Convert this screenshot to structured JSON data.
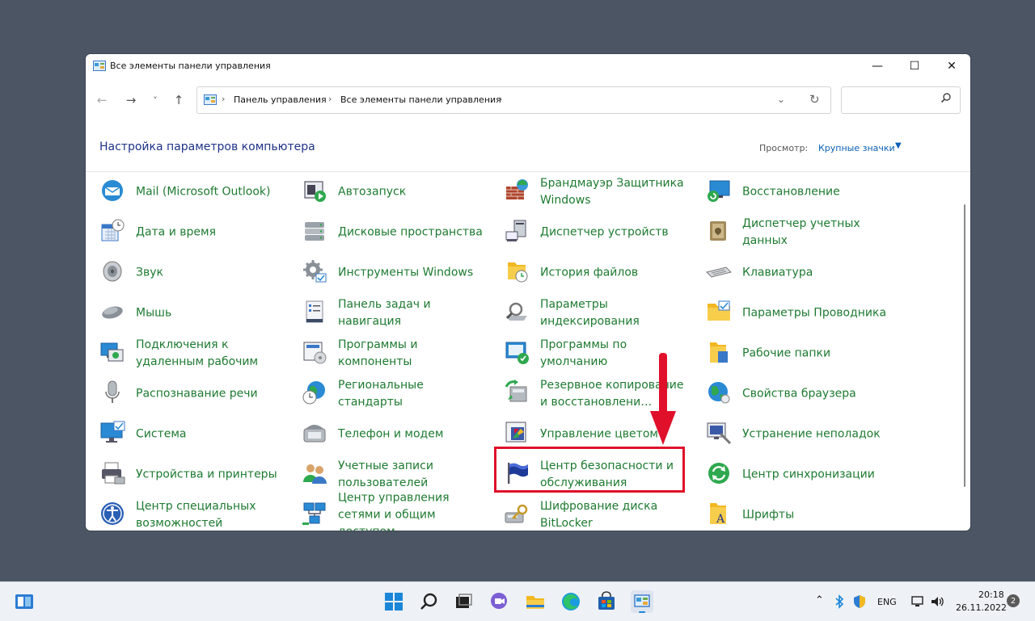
{
  "window": {
    "title": "Все элементы панели управления",
    "controls": {
      "minimize": "—",
      "maximize": "☐",
      "close": "✕"
    }
  },
  "nav": {
    "back": "←",
    "forward": "→",
    "recent": "˅",
    "up": "↑",
    "breadcrumb": [
      "Панель управления",
      "Все элементы панели управления"
    ],
    "breadcrumb_sep": "›",
    "search_placeholder": ""
  },
  "content": {
    "heading": "Настройка параметров компьютера",
    "view_label": "Просмотр:",
    "view_value": "Крупные значки"
  },
  "items": [
    {
      "label": "Mail (Microsoft Outlook)",
      "icon": "mail-icon"
    },
    {
      "label": "Автозапуск",
      "icon": "autoplay-icon"
    },
    {
      "label": "Брандмауэр Защитника Windows",
      "icon": "firewall-icon"
    },
    {
      "label": "Восстановление",
      "icon": "recovery-icon"
    },
    {
      "label": "Дата и время",
      "icon": "calendar-clock-icon"
    },
    {
      "label": "Дисковые пространства",
      "icon": "storage-spaces-icon"
    },
    {
      "label": "Диспетчер устройств",
      "icon": "device-manager-icon"
    },
    {
      "label": "Диспетчер учетных данных",
      "icon": "credential-vault-icon"
    },
    {
      "label": "Звук",
      "icon": "speaker-icon"
    },
    {
      "label": "Инструменты Windows",
      "icon": "gear-tools-icon"
    },
    {
      "label": "История файлов",
      "icon": "file-history-icon"
    },
    {
      "label": "Клавиатура",
      "icon": "keyboard-icon"
    },
    {
      "label": "Мышь",
      "icon": "mouse-icon"
    },
    {
      "label": "Панель задач и навигация",
      "icon": "taskbar-icon"
    },
    {
      "label": "Параметры индексирования",
      "icon": "indexing-icon"
    },
    {
      "label": "Параметры Проводника",
      "icon": "folder-options-icon"
    },
    {
      "label": "Подключения к удаленным рабочим",
      "icon": "remote-desktop-icon"
    },
    {
      "label": "Программы и компоненты",
      "icon": "programs-icon"
    },
    {
      "label": "Программы по умолчанию",
      "icon": "default-programs-icon"
    },
    {
      "label": "Рабочие папки",
      "icon": "work-folders-icon"
    },
    {
      "label": "Распознавание речи",
      "icon": "microphone-icon"
    },
    {
      "label": "Региональные стандарты",
      "icon": "region-clock-icon"
    },
    {
      "label": "Резервное копирование и восстановлени…",
      "icon": "backup-icon"
    },
    {
      "label": "Свойства браузера",
      "icon": "globe-icon"
    },
    {
      "label": "Система",
      "icon": "monitor-check-icon"
    },
    {
      "label": "Телефон и модем",
      "icon": "phone-icon"
    },
    {
      "label": "Управление цветом",
      "icon": "color-management-icon"
    },
    {
      "label": "Устранение неполадок",
      "icon": "troubleshoot-icon"
    },
    {
      "label": "Устройства и принтеры",
      "icon": "printer-icon"
    },
    {
      "label": "Учетные записи пользователей",
      "icon": "users-icon"
    },
    {
      "label": "Центр безопасности и обслуживания",
      "icon": "flag-icon"
    },
    {
      "label": "Центр синхронизации",
      "icon": "sync-icon"
    },
    {
      "label": "Центр специальных возможностей",
      "icon": "accessibility-icon"
    },
    {
      "label": "Центр управления сетями и общим доступом",
      "icon": "network-icon"
    },
    {
      "label": "Шифрование диска BitLocker",
      "icon": "bitlocker-icon"
    },
    {
      "label": "Шрифты",
      "icon": "fonts-icon"
    }
  ],
  "taskbar": {
    "language": "ENG",
    "time": "20:18",
    "date": "26.11.2022",
    "notification_count": "2"
  },
  "colors": {
    "item_label": "#1e7a31",
    "heading": "#1e3287",
    "link": "#0b5fb4",
    "highlight": "#e0102a"
  }
}
